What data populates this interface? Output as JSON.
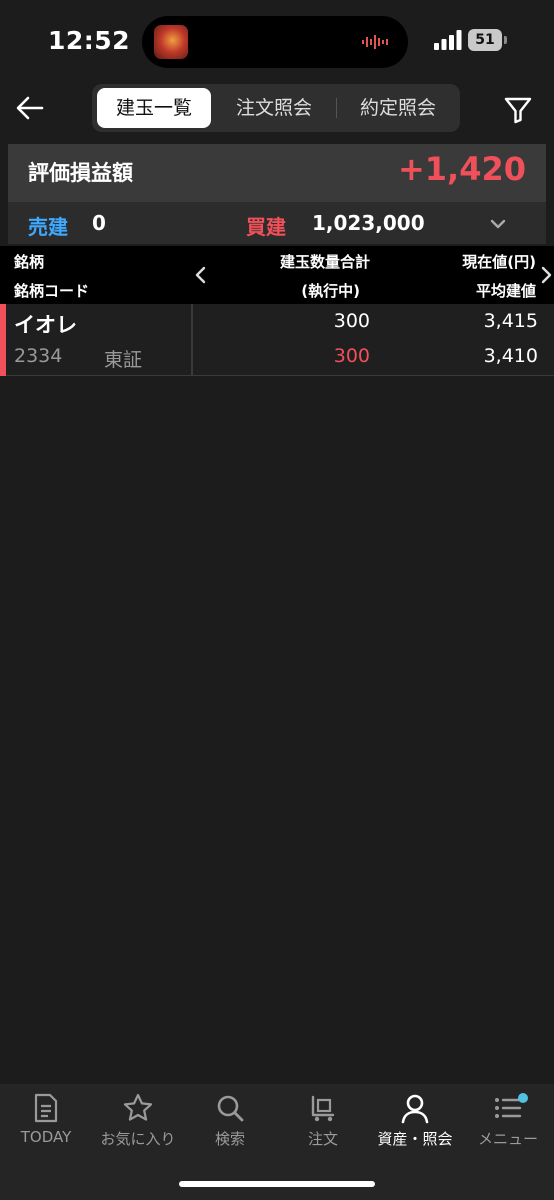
{
  "status_bar": {
    "time": "12:52",
    "battery": "51"
  },
  "header": {
    "tabs": [
      {
        "label": "建玉一覧",
        "active": true
      },
      {
        "label": "注文照会",
        "active": false
      },
      {
        "label": "約定照会",
        "active": false
      }
    ]
  },
  "summary": {
    "pnl_label": "評価損益額",
    "pnl_value": "+1,420",
    "sell_label": "売建",
    "sell_value": "0",
    "buy_label": "買建",
    "buy_value": "1,023,000"
  },
  "table": {
    "headers": {
      "name": "銘柄",
      "code": "銘柄コード",
      "qty_total": "建玉数量合計",
      "qty_exec": "(執行中)",
      "price_now": "現在値(円)",
      "price_avg": "平均建値"
    },
    "rows": [
      {
        "name": "イオレ",
        "code": "2334",
        "market": "東証",
        "qty_total": "300",
        "qty_exec": "300",
        "price_now": "3,415",
        "price_avg": "3,410"
      }
    ]
  },
  "tabbar": {
    "items": [
      {
        "label": "TODAY",
        "icon": "document-icon"
      },
      {
        "label": "お気に入り",
        "icon": "star-icon"
      },
      {
        "label": "検索",
        "icon": "search-icon"
      },
      {
        "label": "注文",
        "icon": "cart-icon"
      },
      {
        "label": "資産・照会",
        "icon": "person-icon",
        "active": true
      },
      {
        "label": "メニュー",
        "icon": "menu-icon"
      }
    ]
  },
  "colors": {
    "profit": "#f0505a",
    "sell": "#3fa9ff",
    "background": "#1c1c1c",
    "badge": "#4fc3e0"
  }
}
